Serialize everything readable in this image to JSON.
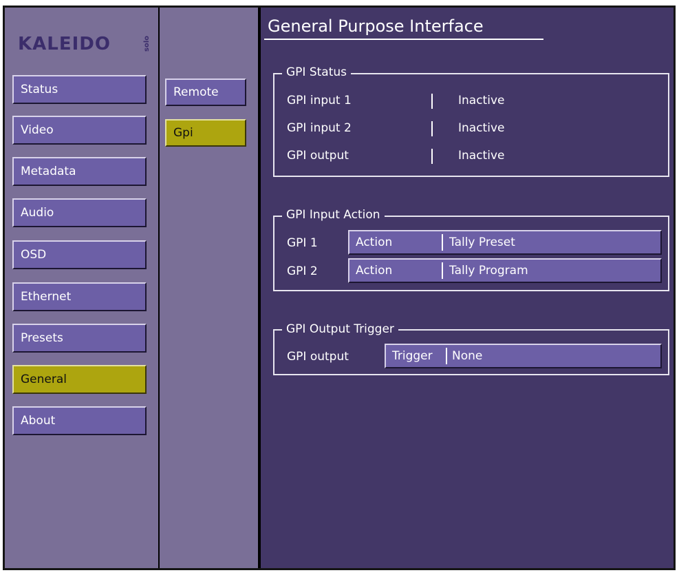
{
  "logo": {
    "main": "KALEIDO",
    "sub": "solo"
  },
  "nav": {
    "items": [
      "Status",
      "Video",
      "Metadata",
      "Audio",
      "OSD",
      "Ethernet",
      "Presets",
      "General",
      "About"
    ],
    "active": "General"
  },
  "subnav": {
    "items": [
      "Remote",
      "Gpi"
    ],
    "active": "Gpi"
  },
  "page": {
    "title": "General Purpose Interface"
  },
  "gpi_status": {
    "title": "GPI Status",
    "rows": [
      {
        "label": "GPI input 1",
        "value": "Inactive"
      },
      {
        "label": "GPI input 2",
        "value": "Inactive"
      },
      {
        "label": "GPI output",
        "value": "Inactive"
      }
    ]
  },
  "gpi_input_action": {
    "title": "GPI Input Action",
    "rows": [
      {
        "label": "GPI 1",
        "field": "Action",
        "value": "Tally Preset"
      },
      {
        "label": "GPI 2",
        "field": "Action",
        "value": "Tally Program"
      }
    ]
  },
  "gpi_output_trigger": {
    "title": "GPI Output Trigger",
    "row": {
      "label": "GPI output",
      "field": "Trigger",
      "value": "None"
    }
  },
  "colors": {
    "panel": "#7a6f97",
    "main": "#433767",
    "button": "#6c5fa6",
    "active": "#ada50f"
  }
}
